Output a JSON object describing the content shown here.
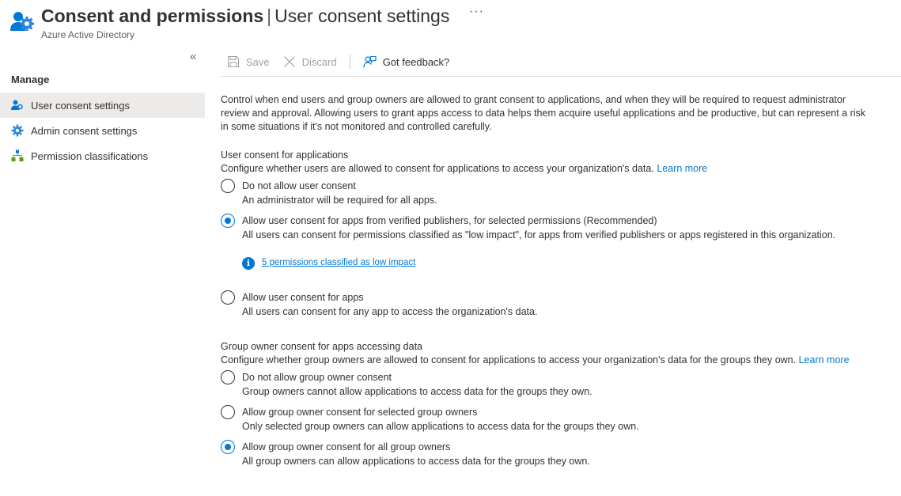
{
  "header": {
    "title_bold": "Consent and permissions",
    "separator": "|",
    "title_rest": "User consent settings",
    "more": "···",
    "subtitle": "Azure Active Directory"
  },
  "sidebar": {
    "collapse": "«",
    "section_label": "Manage",
    "items": [
      {
        "label": "User consent settings",
        "icon": "user-gear-icon",
        "active": true
      },
      {
        "label": "Admin consent settings",
        "icon": "gear-icon",
        "active": false
      },
      {
        "label": "Permission classifications",
        "icon": "hierarchy-icon",
        "active": false
      }
    ]
  },
  "toolbar": {
    "save_label": "Save",
    "discard_label": "Discard",
    "feedback_label": "Got feedback?"
  },
  "content": {
    "intro": "Control when end users and group owners are allowed to grant consent to applications, and when they will be required to request administrator review and approval. Allowing users to grant apps access to data helps them acquire useful applications and be productive, but can represent a risk in some situations if it's not monitored and controlled carefully.",
    "user_consent": {
      "title": "User consent for applications",
      "description": "Configure whether users are allowed to consent for applications to access your organization's data.",
      "learn_more": "Learn more",
      "options": [
        {
          "label": "Do not allow user consent",
          "description": "An administrator will be required for all apps.",
          "checked": false
        },
        {
          "label": "Allow user consent for apps from verified publishers, for selected permissions (Recommended)",
          "description": "All users can consent for permissions classified as \"low impact\", for apps from verified publishers or apps registered in this organization.",
          "checked": true
        },
        {
          "label": "Allow user consent for apps",
          "description": "All users can consent for any app to access the organization's data.",
          "checked": false
        }
      ],
      "info_link": "5 permissions classified as low impact"
    },
    "group_consent": {
      "title": "Group owner consent for apps accessing data",
      "description": "Configure whether group owners are allowed to consent for applications to access your organization's data for the groups they own.",
      "learn_more": "Learn more",
      "options": [
        {
          "label": "Do not allow group owner consent",
          "description": "Group owners cannot allow applications to access data for the groups they own.",
          "checked": false
        },
        {
          "label": "Allow group owner consent for selected group owners",
          "description": "Only selected group owners can allow applications to access data for the groups they own.",
          "checked": false
        },
        {
          "label": "Allow group owner consent for all group owners",
          "description": "All group owners can allow applications to access data for the groups they own.",
          "checked": true
        }
      ]
    }
  },
  "colors": {
    "accent": "#0078d4",
    "text": "#323130",
    "muted": "#605e5c",
    "disabled": "#a19f9d",
    "active_bg": "#edebe9"
  }
}
